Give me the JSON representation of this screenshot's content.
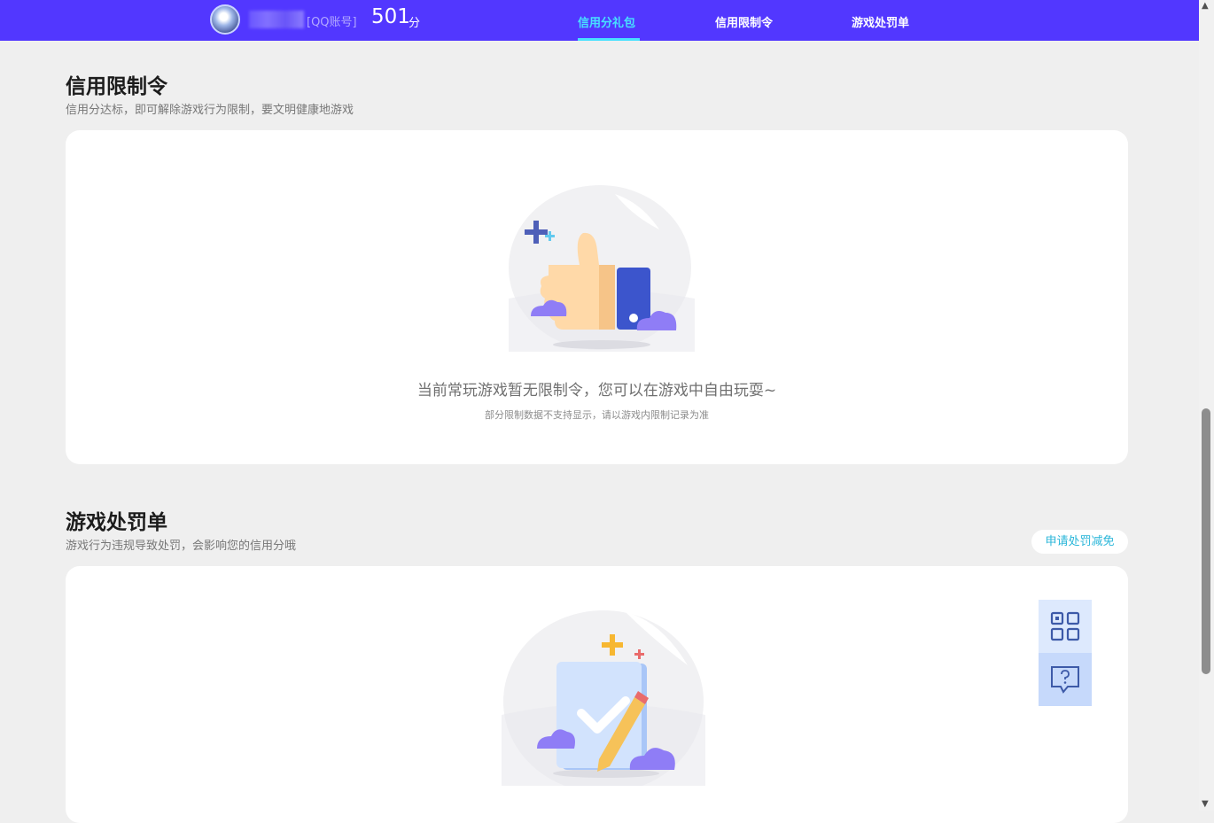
{
  "header": {
    "account_type": "[QQ账号]",
    "score": "501",
    "score_unit": "分",
    "tabs": [
      {
        "label": "信用分礼包",
        "active": true
      },
      {
        "label": "信用限制令",
        "active": false
      },
      {
        "label": "游戏处罚单",
        "active": false
      }
    ],
    "accent_color": "#5237ff",
    "active_tab_color": "#47e1ff"
  },
  "restriction_section": {
    "title": "信用限制令",
    "subtitle": "信用分达标，即可解除游戏行为限制，要文明健康地游戏",
    "illustration": "thumbs-up-illustration",
    "empty_text": "当前常玩游戏暂无限制令，您可以在游戏中自由玩耍~",
    "empty_note": "部分限制数据不支持显示，请以游戏内限制记录为准"
  },
  "penalty_section": {
    "title": "游戏处罚单",
    "subtitle": "游戏行为违规导致处罚，会影响您的信用分哦",
    "apply_button": "申请处罚减免",
    "illustration": "clipboard-check-illustration"
  },
  "floating_tools": [
    {
      "icon": "qr-code-icon"
    },
    {
      "icon": "help-chat-icon"
    }
  ]
}
